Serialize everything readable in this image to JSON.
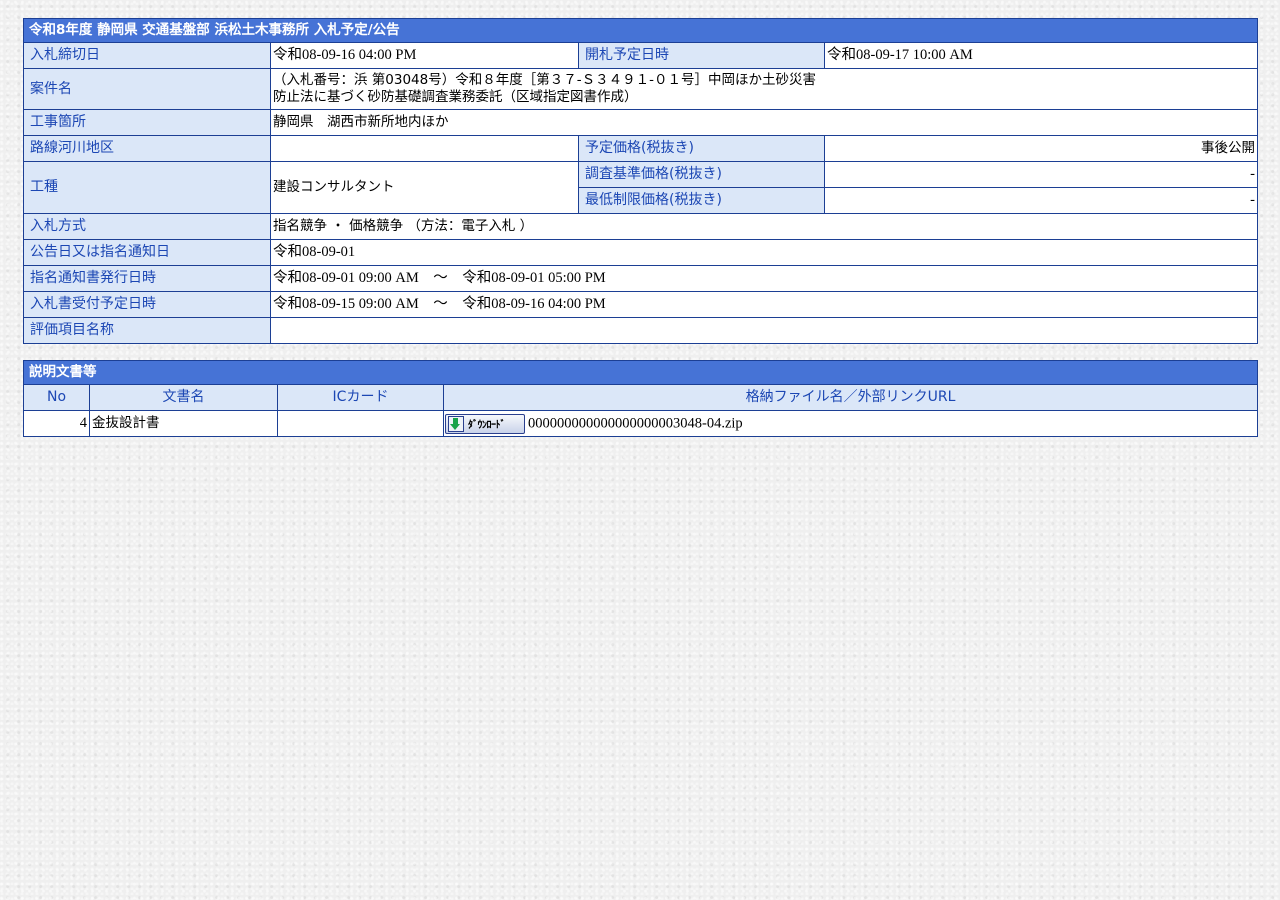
{
  "info_table": {
    "title": "令和8年度 静岡県 交通基盤部 浜松土木事務所 入札予定/公告",
    "bid_deadline_label": "入札締切日",
    "bid_deadline_value": "令和08-09-16 04:00 PM",
    "opening_date_label": "開札予定日時",
    "opening_date_value": "令和08-09-17 10:00 AM",
    "project_name_label": "案件名",
    "project_name_line1": "（入札番号：浜 第03048号）令和８年度［第３７-Ｓ３４９１-０１号］中岡ほか土砂災害",
    "project_name_line2": "防止法に基づく砂防基礎調査業務委託（区域指定図書作成）",
    "location_label": "工事箇所",
    "location_value": "静岡県　湖西市新所地内ほか",
    "route_label": "路線河川地区",
    "route_value": "",
    "planned_price_label": "予定価格(税抜き)",
    "planned_price_value": "事後公開",
    "work_type_label": "工種",
    "work_type_value": "建設コンサルタント",
    "survey_price_label": "調査基準価格(税抜き)",
    "survey_price_value": "-",
    "min_price_label": "最低制限価格(税抜き)",
    "min_price_value": "-",
    "bid_method_label": "入札方式",
    "bid_method_value": "指名競争 ・ 価格競争 （方法：電子入札 ）",
    "notice_date_label": "公告日又は指名通知日",
    "notice_date_value": "令和08-09-01",
    "nomination_issue_label": "指名通知書発行日時",
    "nomination_issue_value": "令和08-09-01 09:00 AM　～　令和08-09-01 05:00 PM",
    "bid_reception_label": "入札書受付予定日時",
    "bid_reception_value": "令和08-09-15 09:00 AM　～　令和08-09-16 04:00 PM",
    "evaluation_label": "評価項目名称",
    "evaluation_value": ""
  },
  "docs_table": {
    "title": "説明文書等",
    "columns": {
      "no": "No",
      "doc_name": "文書名",
      "ic_card": "ICカード",
      "file": "格納ファイル名／外部リンクURL"
    },
    "rows": [
      {
        "no": "4",
        "doc_name": "金抜設計書",
        "ic_card": "",
        "download_label": "ﾀﾞｳﾝﾛｰﾄﾞ",
        "file_name": "000000000000000000003048-04.zip"
      }
    ]
  },
  "colors": {
    "header_bg": "#4673d6",
    "label_bg": "#dbe7f8",
    "label_text": "#1c47b4",
    "border": "#1c3f94",
    "download_arrow": "#18a34a"
  },
  "icons": {
    "download": "download-arrow-icon"
  }
}
